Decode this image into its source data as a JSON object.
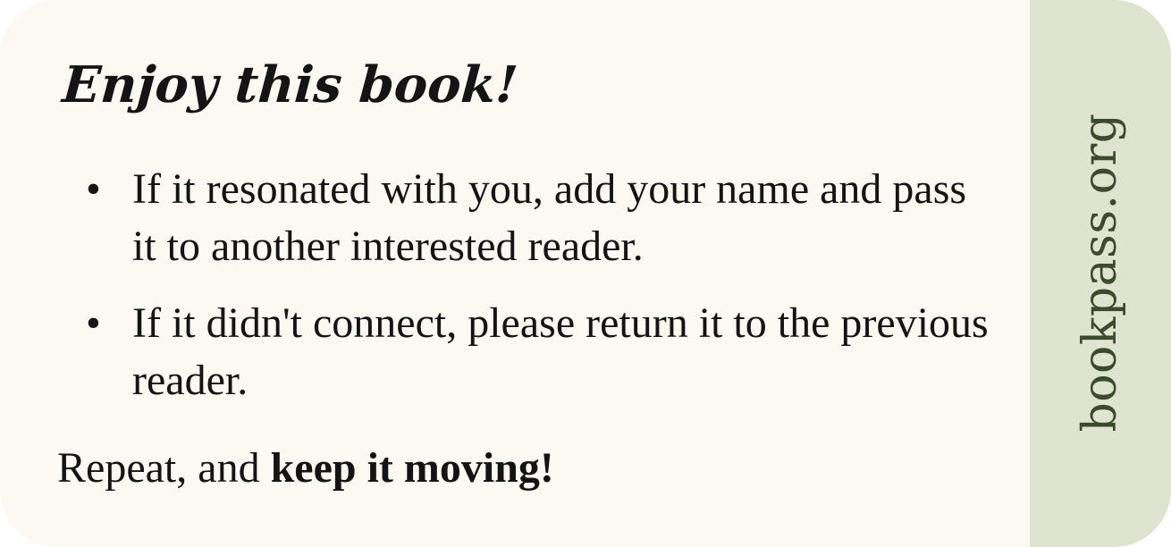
{
  "card": {
    "heading": "Enjoy this book!",
    "items": [
      {
        "bullet": "•",
        "text": "If it resonated with you, add your name and pass it to another interested reader."
      },
      {
        "bullet": "•",
        "text": "If it didn't connect, please return it to the previous reader."
      }
    ],
    "footer": {
      "plain": "Repeat, and ",
      "bold": "keep it moving!"
    },
    "side_label": "bookpass.org"
  },
  "colors": {
    "card_background": "#fcf9f2",
    "side_band": "#dfe4d1",
    "side_text": "#3d4a2d",
    "text": "#141414"
  }
}
